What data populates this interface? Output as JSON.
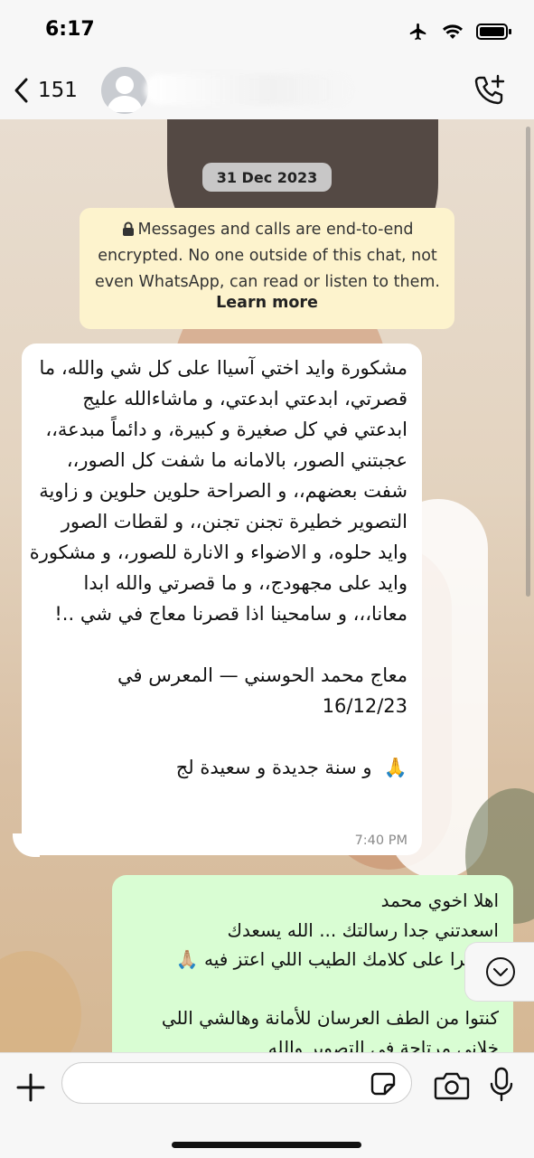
{
  "status_bar": {
    "time": "6:17",
    "icons": [
      "airplane-icon",
      "wifi-icon",
      "battery-icon"
    ]
  },
  "header": {
    "back_count": "151",
    "icons": [
      "chevron-left-icon",
      "avatar-icon",
      "phone-add-icon"
    ]
  },
  "chat": {
    "date": "31 Dec 2023",
    "encryption": {
      "text": "Messages and calls are end-to-end encrypted. No one outside of this chat, not even WhatsApp, can read or listen to them.",
      "link": "Learn more"
    },
    "incoming": {
      "text": "مشكورة وايد اختي آسياا على كل شي والله، ما قصرتي، ابدعتي ابدعتي، و ماشاءالله عليج ابدعتي في كل صغيرة و كبيرة، و دائماً مبدعة،، عجبتني الصور، بالامانه ما شفت كل الصور،، شفت بعضهم،، و الصراحة حلوين حلوين و زاوية التصوير خطيرة تجنن تجنن،، و لقطات الصور وايد حلوه، و الاضواء و الانارة للصور،، و مشكورة وايد على مجهودج،، و ما قصرتي والله ابدا معانا،،، و سامحينا اذا قصرنا معاج في شي ..!\n\nمعاج محمد الحوسني — المعرس في 16/12/23\n\n🙏  و سنة جديدة و سعيدة لج",
      "time": "7:40 PM"
    },
    "outgoing": {
      "text": "اهلا اخوي محمد\nاسعدتني جدا رسالتك ... الله يسعدك\nوشكرا على كلامك الطيب اللي اعتز فيه 🙏🏼\n\nكنتوا من الطف العرسان للأمانة وهالشي اللي\nخلاني مرتاحة في التصوير والله"
    }
  },
  "input": {
    "placeholder": "",
    "icons": [
      "plus-icon",
      "sticker-icon",
      "camera-icon",
      "microphone-icon"
    ]
  },
  "colors": {
    "incoming_bubble": "#ffffff",
    "outgoing_bubble": "#d9fdd3",
    "encryption_notice": "#fdf3cd",
    "bar_background": "#f7f7f7"
  }
}
